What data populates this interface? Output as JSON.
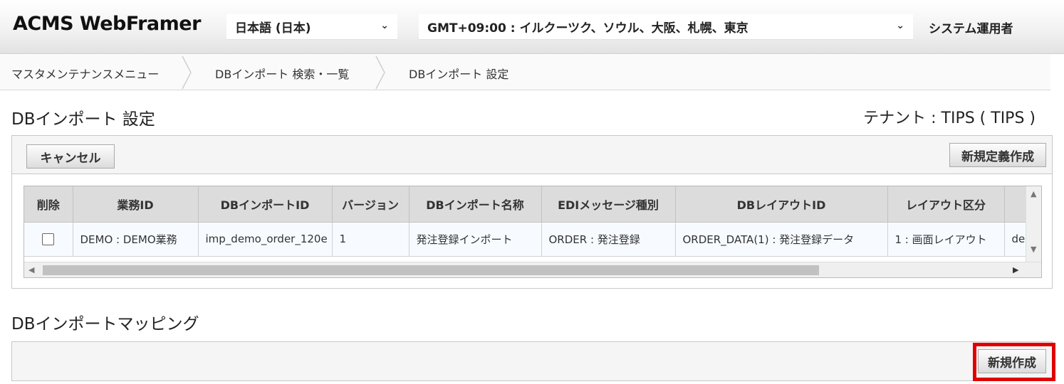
{
  "header": {
    "logo": "ACMS WebFramer",
    "language": "日本語 (日本)",
    "timezone": "GMT+09:00 : イルクーツク、ソウル、大阪、札幌、東京",
    "user": "システム運用者"
  },
  "breadcrumb": [
    "マスタメンテナンスメニュー",
    "DBインポート 検索・一覧",
    "DBインポート 設定"
  ],
  "page": {
    "title": "DBインポート 設定",
    "tenant": "テナント : TIPS ( TIPS )"
  },
  "toolbar": {
    "cancel": "キャンセル",
    "new_definition": "新規定義作成"
  },
  "table": {
    "headers": [
      "削除",
      "業務ID",
      "DBインポートID",
      "バージョン",
      "DBインポート名称",
      "EDIメッセージ種別",
      "DBレイアウトID",
      "レイアウト区分",
      ""
    ],
    "row": [
      "",
      "DEMO : DEMO業務",
      "imp_demo_order_120e",
      "1",
      "発注登録インポート",
      "ORDER : 発注登録",
      "ORDER_DATA(1) : 発注登録データ",
      "1 : 画面レイアウト",
      "de"
    ]
  },
  "mapping": {
    "title": "DBインポートマッピング",
    "new_button": "新規作成"
  },
  "colors": {
    "highlight": "#e00000",
    "header_bg": "#f1f1f1"
  }
}
